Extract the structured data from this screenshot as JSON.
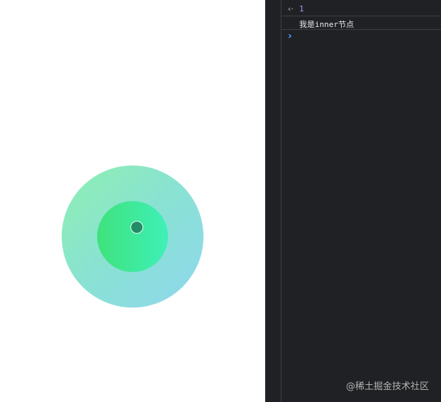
{
  "console": {
    "result_arrow": "‹·",
    "result_value": "1",
    "log_message": "我是inner节点",
    "prompt_symbol": "›"
  },
  "watermark": {
    "text": "@稀土掘金技术社区"
  },
  "colors": {
    "viewport_background": "#ffffff",
    "devtools_background": "#202124",
    "outer_circle_start": "#8ef0b0",
    "outer_circle_end": "#8fd7ee",
    "inner_circle_start": "#3fe27c",
    "inner_circle_end": "#3ff0b8",
    "center_dot": "#238c67",
    "result_value": "#9aa0ff",
    "prompt_symbol": "#4da3ff"
  },
  "icons": {
    "result": "result-arrow-icon",
    "prompt": "console-prompt-icon"
  }
}
